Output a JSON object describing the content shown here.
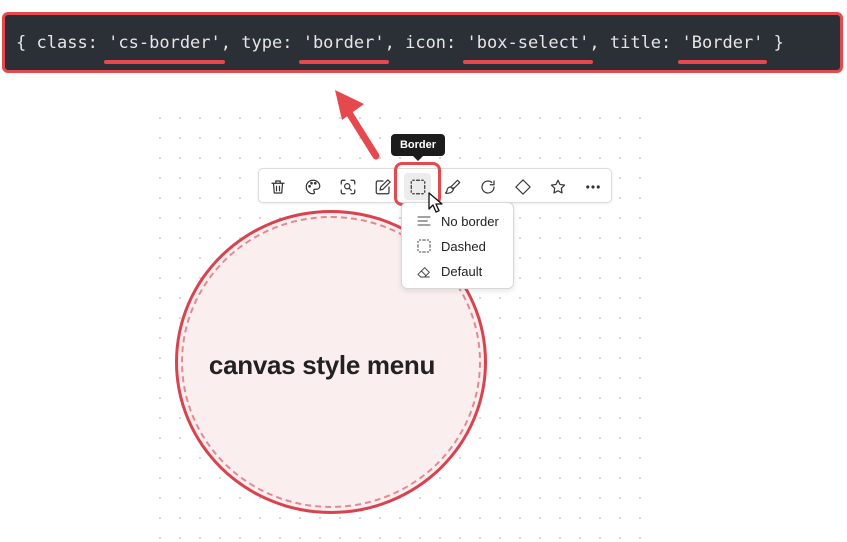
{
  "code_snippet": {
    "open_brace": "{",
    "key_class": "class:",
    "val_class": "'cs-border'",
    "sep1": ",",
    "key_type": "type:",
    "val_type": "'border'",
    "sep2": ",",
    "key_icon": "icon:",
    "val_icon": "'box-select'",
    "sep3": ",",
    "key_title": "title:",
    "val_title": "'Border'",
    "close_brace": "}"
  },
  "canvas": {
    "node_label": "canvas style menu"
  },
  "toolbar": {
    "buttons": [
      {
        "icon": "trash-icon"
      },
      {
        "icon": "palette-icon"
      },
      {
        "icon": "zoom-to-selection-icon"
      },
      {
        "icon": "edit-icon"
      },
      {
        "icon": "box-select-icon",
        "active": true
      },
      {
        "icon": "brush-icon"
      },
      {
        "icon": "rotate-icon"
      },
      {
        "icon": "diamond-icon"
      },
      {
        "icon": "star-icon"
      },
      {
        "icon": "more-icon"
      }
    ],
    "tooltip": "Border"
  },
  "border_menu": {
    "items": [
      {
        "label": "No border",
        "icon": "lines-icon"
      },
      {
        "label": "Dashed",
        "icon": "box-select-icon"
      },
      {
        "label": "Default",
        "icon": "eraser-icon"
      }
    ]
  },
  "colors": {
    "accent_red": "#e5484d",
    "code_bg": "#2b2f36",
    "node_fill": "#fbeeee",
    "node_border": "#d7434f"
  }
}
